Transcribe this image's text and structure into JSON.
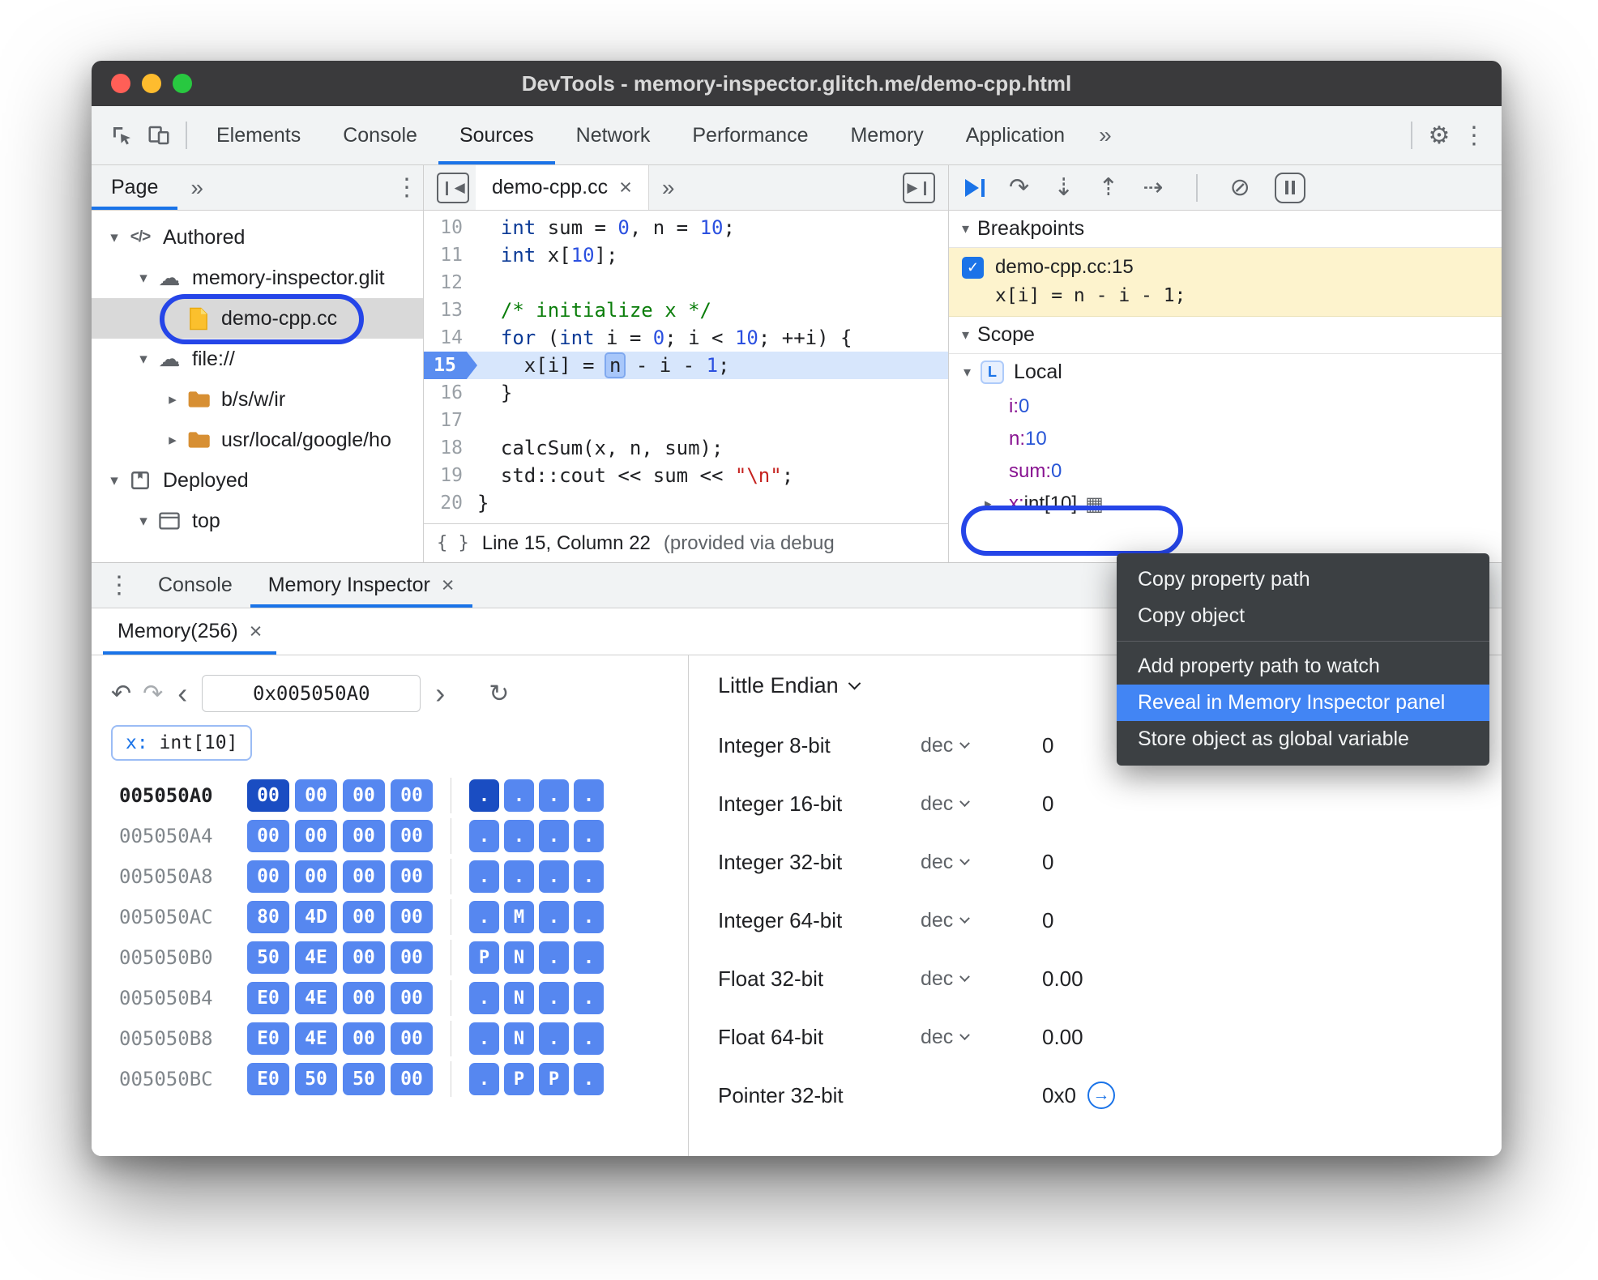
{
  "window_title": "DevTools - memory-inspector.glitch.me/demo-cpp.html",
  "main_toolbar": {
    "tabs": [
      "Elements",
      "Console",
      "Sources",
      "Network",
      "Performance",
      "Memory",
      "Application"
    ],
    "active_tab": "Sources",
    "more_tabs": "»"
  },
  "sidebar": {
    "tab_label": "Page",
    "more_label": "»",
    "tree": [
      {
        "label": "Authored",
        "icon": "code",
        "exp": "open",
        "level": 0
      },
      {
        "label": "memory-inspector.glit",
        "icon": "cloud",
        "exp": "open",
        "level": 1
      },
      {
        "label": "demo-cpp.cc",
        "icon": "file",
        "exp": "none",
        "level": 2,
        "selected": true
      },
      {
        "label": "file://",
        "icon": "cloud",
        "exp": "open",
        "level": 1
      },
      {
        "label": "b/s/w/ir",
        "icon": "folder",
        "exp": "closed",
        "level": 2
      },
      {
        "label": "usr/local/google/ho",
        "icon": "folder",
        "exp": "closed",
        "level": 2
      },
      {
        "label": "Deployed",
        "icon": "package",
        "exp": "open",
        "level": 0
      },
      {
        "label": "top",
        "icon": "frame",
        "exp": "open",
        "level": 1
      }
    ]
  },
  "editor": {
    "tab_label": "demo-cpp.cc",
    "more_label": "»",
    "status_line": "Line 15, Column 22",
    "status_extra": "(provided via debug",
    "execution_line": 15,
    "lines": [
      {
        "n": 10,
        "t": [
          [
            "  ",
            "p"
          ],
          [
            "int",
            "k"
          ],
          [
            " sum = ",
            "p"
          ],
          [
            "0",
            "n"
          ],
          [
            ", n = ",
            "p"
          ],
          [
            "10",
            "n"
          ],
          [
            ";",
            "p"
          ]
        ]
      },
      {
        "n": 11,
        "t": [
          [
            "  ",
            "p"
          ],
          [
            "int",
            "k"
          ],
          [
            " x[",
            "p"
          ],
          [
            "10",
            "n"
          ],
          [
            "];",
            "p"
          ]
        ]
      },
      {
        "n": 12,
        "t": []
      },
      {
        "n": 13,
        "t": [
          [
            "  ",
            "p"
          ],
          [
            "/* initialize x */",
            "c"
          ]
        ]
      },
      {
        "n": 14,
        "t": [
          [
            "  ",
            "p"
          ],
          [
            "for",
            "k"
          ],
          [
            " (",
            "p"
          ],
          [
            "int",
            "k"
          ],
          [
            " i = ",
            "p"
          ],
          [
            "0",
            "n"
          ],
          [
            "; i < ",
            "p"
          ],
          [
            "10",
            "n"
          ],
          [
            "; ++i) {",
            "p"
          ]
        ]
      },
      {
        "n": 15,
        "t": [
          [
            "    x[i] = ",
            "p"
          ],
          [
            "n",
            "h"
          ],
          [
            " - i - ",
            "p"
          ],
          [
            "1",
            "n"
          ],
          [
            ";",
            "p"
          ]
        ]
      },
      {
        "n": 16,
        "t": [
          [
            "  }",
            "p"
          ]
        ]
      },
      {
        "n": 17,
        "t": []
      },
      {
        "n": 18,
        "t": [
          [
            "  calcSum(x, n, sum);",
            "p"
          ]
        ]
      },
      {
        "n": 19,
        "t": [
          [
            "  std::cout << sum << ",
            "p"
          ],
          [
            "\"\\n\"",
            "s"
          ],
          [
            ";",
            "p"
          ]
        ]
      },
      {
        "n": 20,
        "t": [
          [
            "}",
            "p"
          ]
        ]
      }
    ]
  },
  "debug": {
    "breakpoints_title": "Breakpoints",
    "breakpoint": {
      "checked": true,
      "label": "demo-cpp.cc:15",
      "code": "x[i] = n - i - 1;"
    },
    "scope_title": "Scope",
    "scope_name": "Local",
    "local_badge": "L",
    "vars": [
      {
        "name": "i",
        "value": "0",
        "kind": "num"
      },
      {
        "name": "n",
        "value": "10",
        "kind": "num"
      },
      {
        "name": "sum",
        "value": "0",
        "kind": "num"
      },
      {
        "name": "x",
        "value": "int[10]",
        "kind": "obj",
        "expandable": true,
        "memory_icon": true
      }
    ]
  },
  "context_menu": {
    "items": [
      {
        "label": "Copy property path"
      },
      {
        "label": "Copy object"
      },
      {
        "sep": true
      },
      {
        "label": "Add property path to watch"
      },
      {
        "label": "Reveal in Memory Inspector panel",
        "highlighted": true
      },
      {
        "label": "Store object as global variable"
      }
    ]
  },
  "drawer": {
    "tabs": [
      {
        "label": "Console"
      },
      {
        "label": "Memory Inspector",
        "active": true,
        "closable": true
      }
    ],
    "inner_tab": "Memory(256)",
    "address_value": "0x005050A0",
    "tag_label": "x: int[10]",
    "memory": {
      "rows": [
        {
          "addr": "005050A0",
          "bytes": [
            "00",
            "00",
            "00",
            "00"
          ],
          "ascii": [
            ".",
            ".",
            ".",
            "."
          ],
          "sel": 0,
          "addr_active": true
        },
        {
          "addr": "005050A4",
          "bytes": [
            "00",
            "00",
            "00",
            "00"
          ],
          "ascii": [
            ".",
            ".",
            ".",
            "."
          ]
        },
        {
          "addr": "005050A8",
          "bytes": [
            "00",
            "00",
            "00",
            "00"
          ],
          "ascii": [
            ".",
            ".",
            ".",
            "."
          ]
        },
        {
          "addr": "005050AC",
          "bytes": [
            "80",
            "4D",
            "00",
            "00"
          ],
          "ascii": [
            ".",
            "M",
            ".",
            "."
          ]
        },
        {
          "addr": "005050B0",
          "bytes": [
            "50",
            "4E",
            "00",
            "00"
          ],
          "ascii": [
            "P",
            "N",
            ".",
            "."
          ]
        },
        {
          "addr": "005050B4",
          "bytes": [
            "E0",
            "4E",
            "00",
            "00"
          ],
          "ascii": [
            ".",
            "N",
            ".",
            "."
          ]
        },
        {
          "addr": "005050B8",
          "bytes": [
            "E0",
            "4E",
            "00",
            "00"
          ],
          "ascii": [
            ".",
            "N",
            ".",
            "."
          ]
        },
        {
          "addr": "005050BC",
          "bytes": [
            "E0",
            "50",
            "50",
            "00"
          ],
          "ascii": [
            ".",
            "P",
            "P",
            "."
          ]
        }
      ]
    },
    "interpreter": {
      "endianness": "Little Endian",
      "rows": [
        {
          "label": "Integer 8-bit",
          "mode": "dec",
          "value": "0"
        },
        {
          "label": "Integer 16-bit",
          "mode": "dec",
          "value": "0"
        },
        {
          "label": "Integer 32-bit",
          "mode": "dec",
          "value": "0"
        },
        {
          "label": "Integer 64-bit",
          "mode": "dec",
          "value": "0"
        },
        {
          "label": "Float 32-bit",
          "mode": "dec",
          "value": "0.00"
        },
        {
          "label": "Float 64-bit",
          "mode": "dec",
          "value": "0.00"
        },
        {
          "label": "Pointer 32-bit",
          "mode": "",
          "value": "0x0",
          "jump": true
        }
      ]
    }
  },
  "colors": {
    "accent": "#1a73e8",
    "annotation": "#2545e8",
    "byte_highlight": "#5687f0",
    "byte_selected": "#1a4dc2",
    "breakpoint_bg": "#fdf3cd"
  }
}
